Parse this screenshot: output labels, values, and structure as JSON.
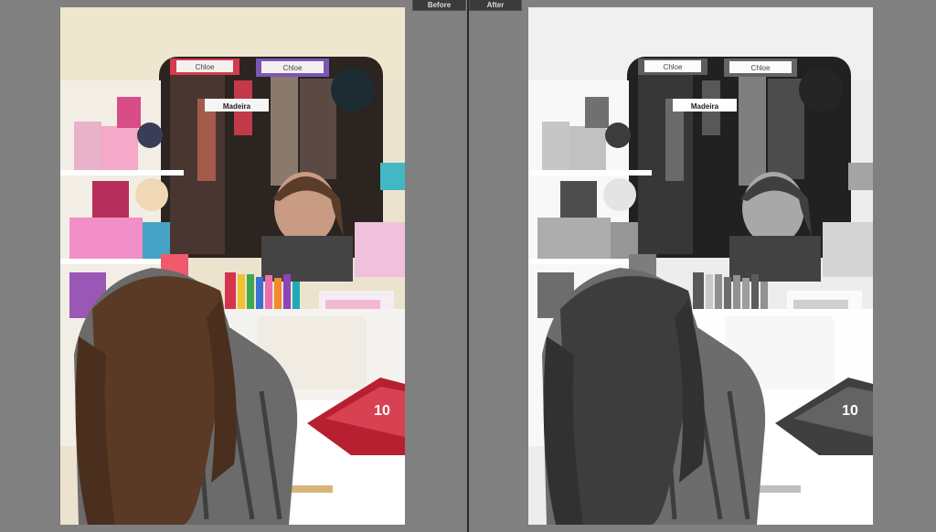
{
  "toolbar": {
    "before_label": "Before",
    "after_label": "After"
  },
  "photo": {
    "mirror_label_1": "Chloe",
    "mirror_label_2": "Chloe",
    "mirror_sticker": "Madeira",
    "magazine_text": "10"
  },
  "colors": {
    "background": "#808080",
    "divider": "#2a2a2a",
    "tab_bg": "#3b3b3b"
  }
}
